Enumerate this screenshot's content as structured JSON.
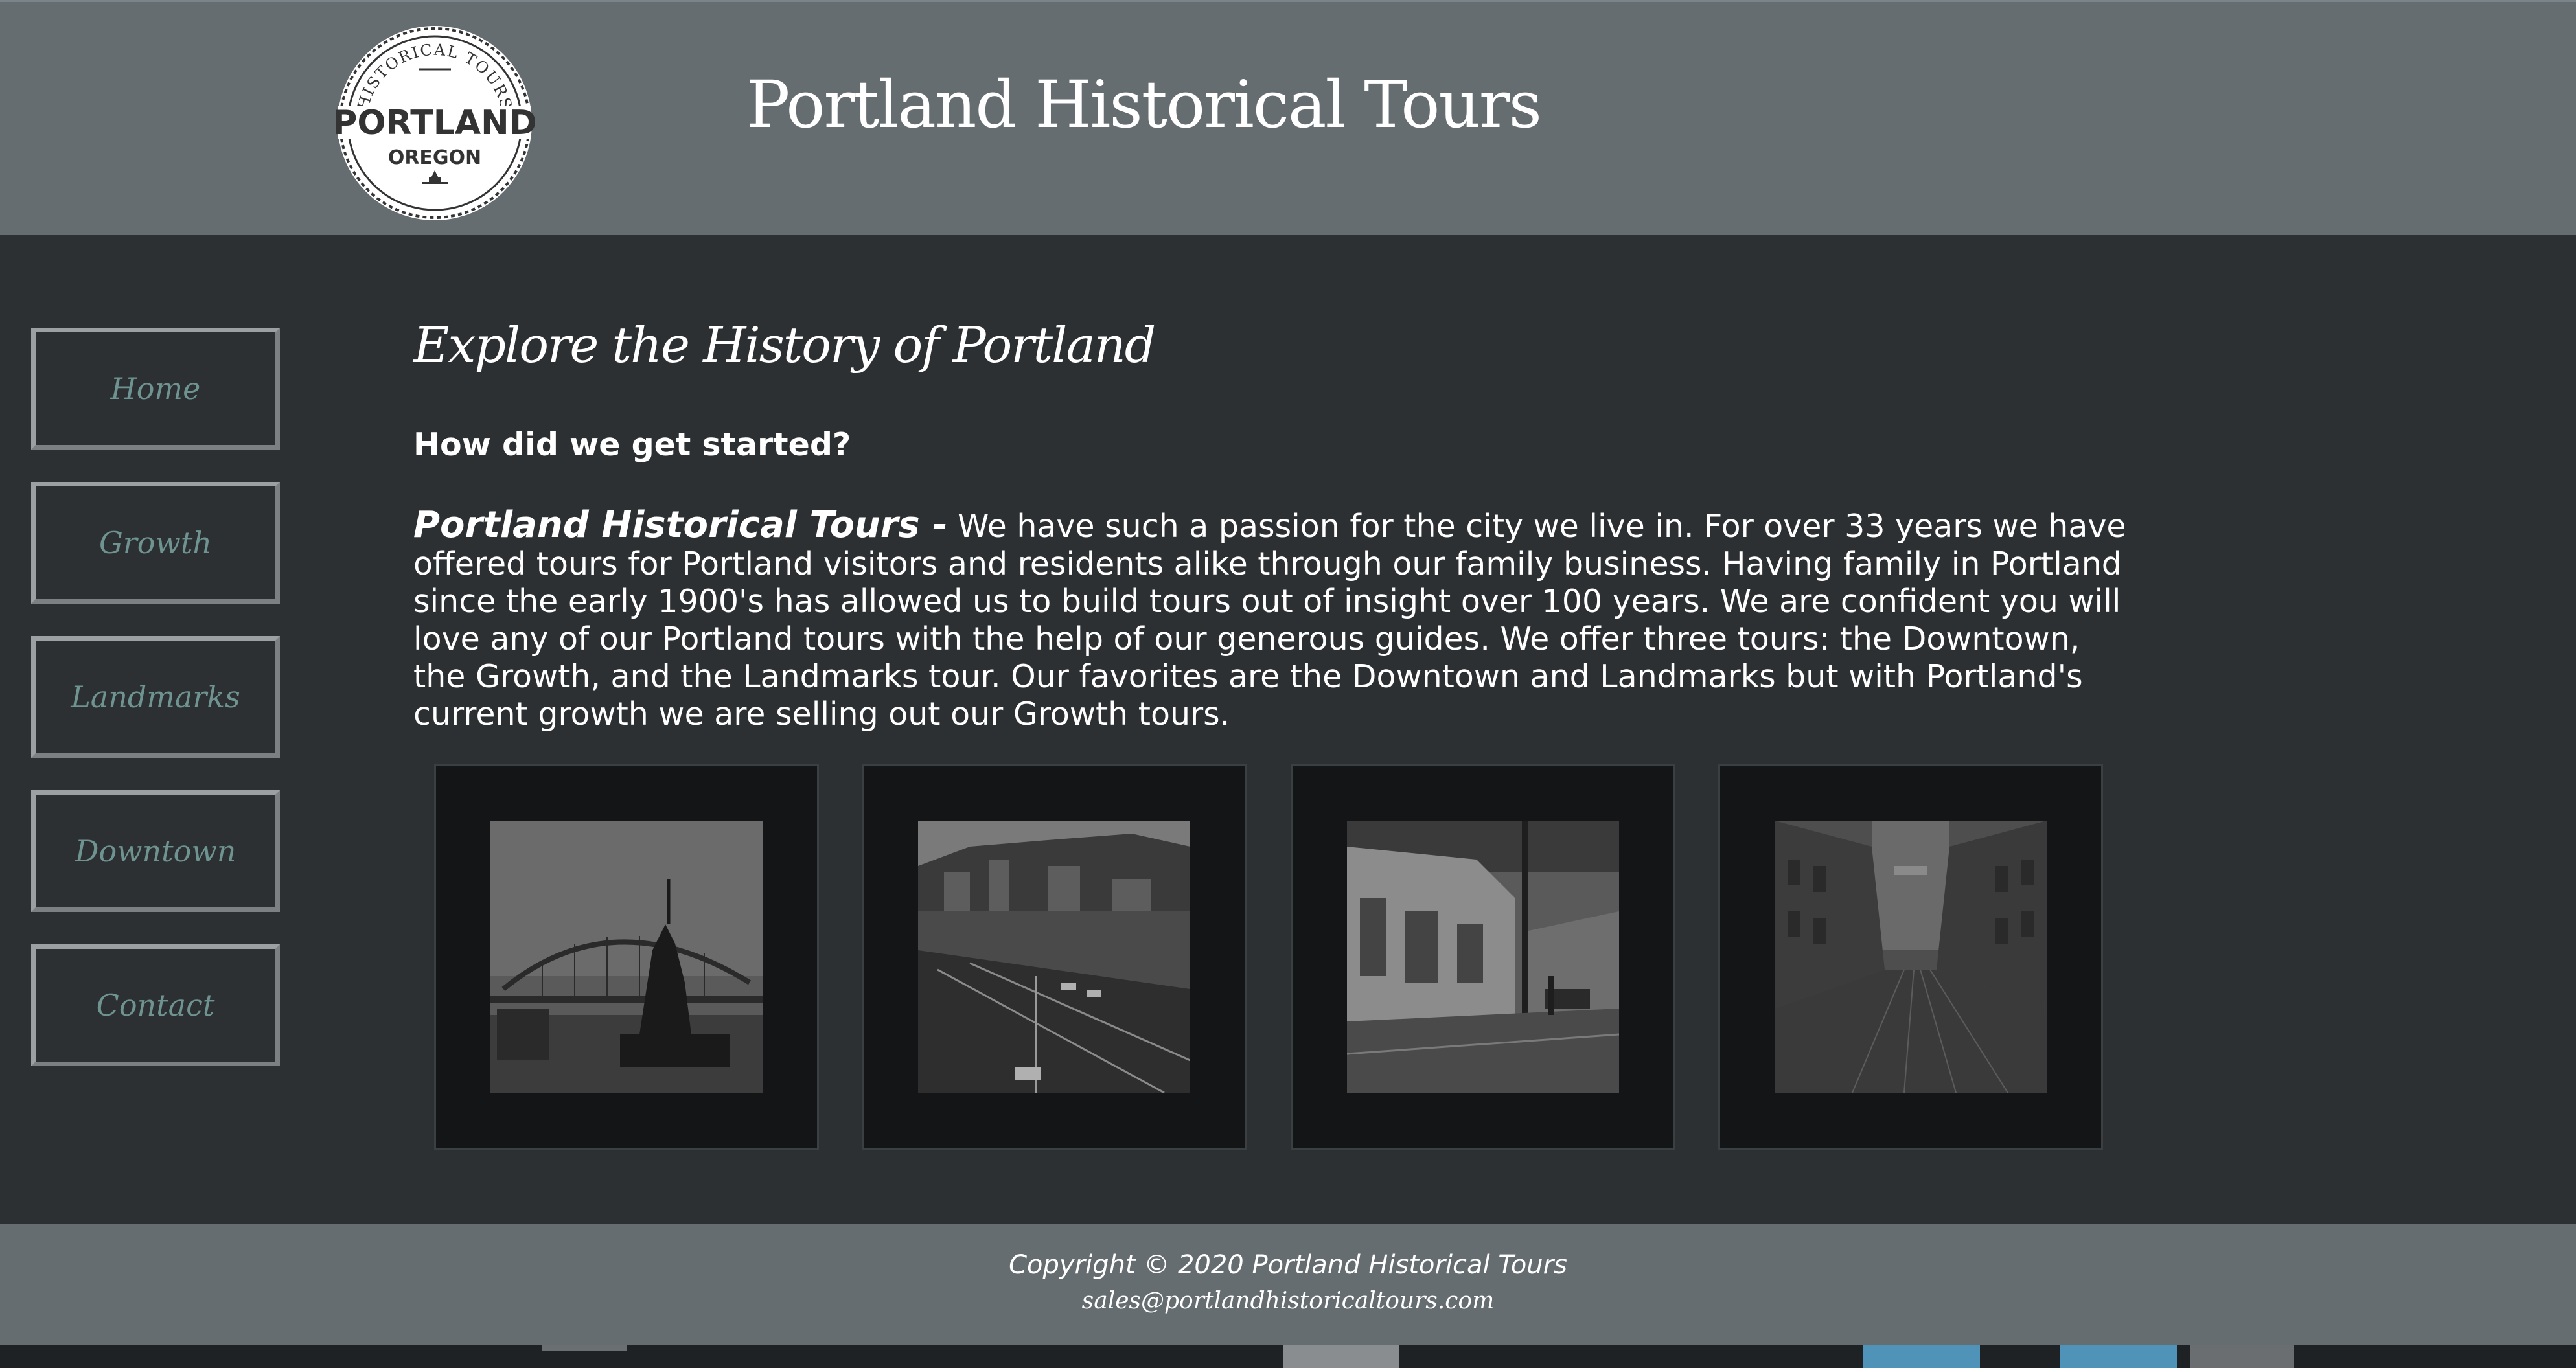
{
  "header": {
    "title": "Portland Historical Tours",
    "logo": {
      "ring_text": "HISTORICAL TOURS",
      "main_text": "PORTLAND",
      "sub_text": "OREGON"
    }
  },
  "nav": {
    "items": [
      {
        "label": "Home"
      },
      {
        "label": "Growth"
      },
      {
        "label": "Landmarks"
      },
      {
        "label": "Downtown"
      },
      {
        "label": "Contact"
      }
    ]
  },
  "main": {
    "heading": "Explore the History of Portland",
    "subheading": "How did we get started?",
    "intro_lead": "Portland Historical Tours -",
    "intro_body": " We have such a passion for the city we live in. For over 33 years we have offered tours for Portland visitors and residents alike through our family business. Having family in Portland since the early 1900's has allowed us to build tours out of insight over 100 years. We are confident you will love any of our Portland tours with the help of our generous guides. We offer three tours: the Downtown, the Growth, and the Landmarks tour. Our favorites are the Downtown and Landmarks but with Portland's current growth we are selling out our Growth tours."
  },
  "gallery": {
    "photos": [
      {
        "subject": "bridge-statue-photo"
      },
      {
        "subject": "city-highway-photo"
      },
      {
        "subject": "street-buildings-photo"
      },
      {
        "subject": "downtown-street-photo"
      }
    ]
  },
  "footer": {
    "copyright": "Copyright © 2020 Portland Historical Tours",
    "email": "sales@portlandhistoricaltours.com"
  },
  "colors": {
    "header_bg": "#656d71",
    "body_bg": "#2c3033",
    "nav_text": "#6e9391",
    "frame_bg": "#141516"
  }
}
